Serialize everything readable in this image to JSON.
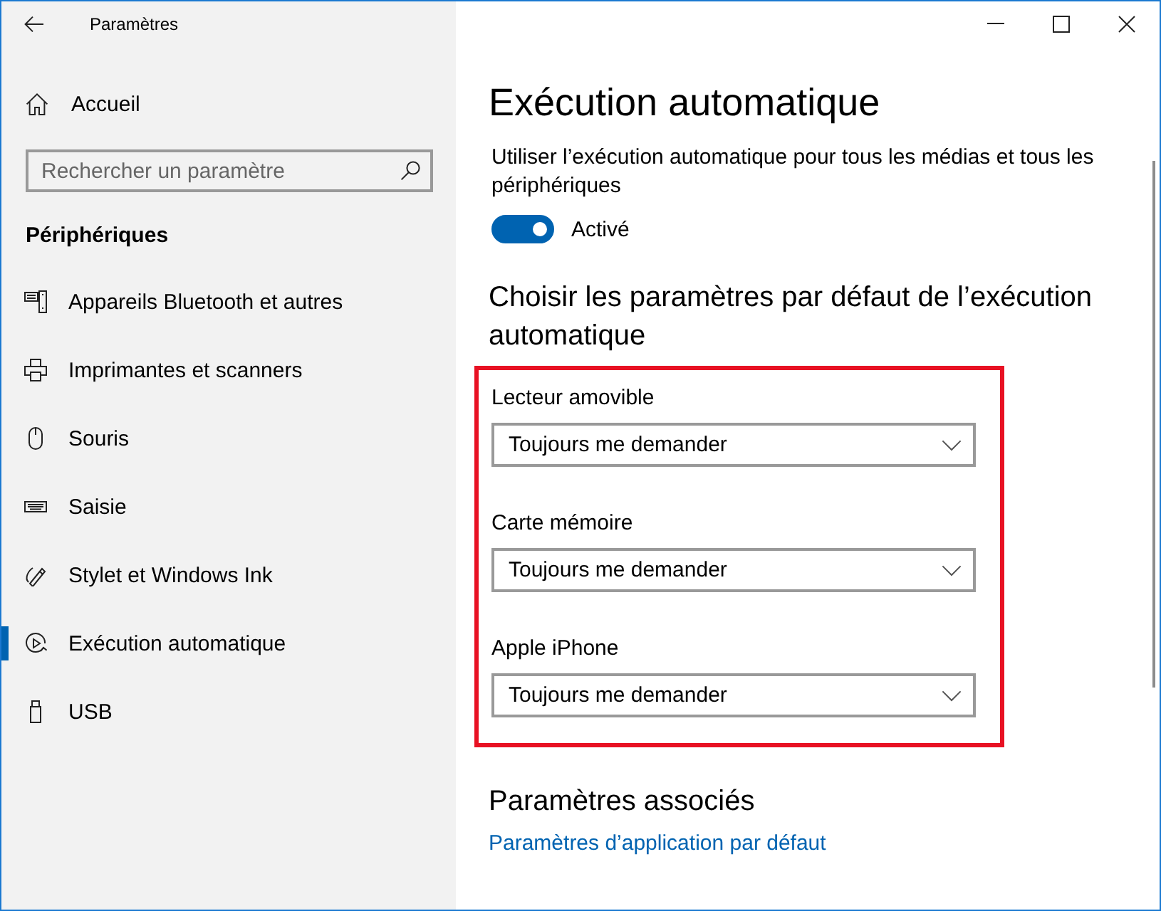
{
  "window": {
    "title": "Paramètres"
  },
  "sidebar": {
    "home": "Accueil",
    "search": {
      "placeholder": "Rechercher un paramètre"
    },
    "section": "Périphériques",
    "items": [
      {
        "label": "Appareils Bluetooth et autres",
        "kind": "devices",
        "selected": false
      },
      {
        "label": "Imprimantes et scanners",
        "kind": "printer",
        "selected": false
      },
      {
        "label": "Souris",
        "kind": "mouse",
        "selected": false
      },
      {
        "label": "Saisie",
        "kind": "keyboard",
        "selected": false
      },
      {
        "label": "Stylet et Windows Ink",
        "kind": "pen",
        "selected": false
      },
      {
        "label": "Exécution automatique",
        "kind": "autoplay",
        "selected": true
      },
      {
        "label": "USB",
        "kind": "usb",
        "selected": false
      }
    ]
  },
  "content": {
    "title": "Exécution automatique",
    "autoplay": {
      "description": "Utiliser l’exécution automatique pour tous les médias et tous les périphériques",
      "on": true,
      "state_label": "Activé"
    },
    "defaults": {
      "heading": "Choisir les paramètres par défaut de l’exécution automatique",
      "highlighted": true,
      "settings": [
        {
          "label": "Lecteur amovible",
          "value": "Toujours me demander"
        },
        {
          "label": "Carte mémoire",
          "value": "Toujours me demander"
        },
        {
          "label": "Apple iPhone",
          "value": "Toujours me demander"
        }
      ]
    },
    "related": {
      "heading": "Paramètres associés",
      "links": [
        "Paramètres d’application par défaut"
      ]
    }
  }
}
